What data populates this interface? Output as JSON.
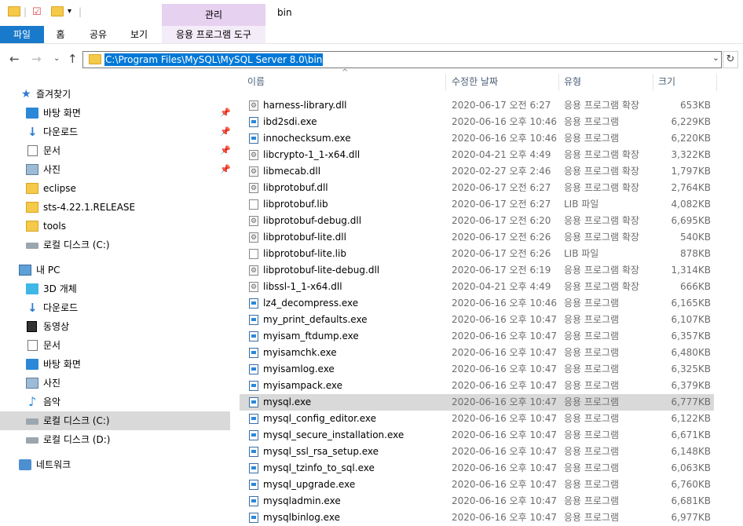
{
  "window": {
    "title": "bin",
    "manage_tab": "관리"
  },
  "ribbon": {
    "tabs": [
      "파일",
      "홈",
      "공유",
      "보기",
      "응용 프로그램 도구"
    ]
  },
  "address": {
    "path": "C:\\Program Files\\MySQL\\MySQL Server 8.0\\bin"
  },
  "nav": {
    "items": [
      {
        "label": "즐겨찾기",
        "icon": "star-icon"
      },
      {
        "label": "바탕 화면",
        "icon": "desktop-icon",
        "pinned": true
      },
      {
        "label": "다운로드",
        "icon": "download-icon",
        "pinned": true
      },
      {
        "label": "문서",
        "icon": "document-icon",
        "pinned": true
      },
      {
        "label": "사진",
        "icon": "pictures-icon",
        "pinned": true
      },
      {
        "label": "eclipse",
        "icon": "folder-icon"
      },
      {
        "label": "sts-4.22.1.RELEASE",
        "icon": "folder-icon"
      },
      {
        "label": "tools",
        "icon": "folder-icon"
      },
      {
        "label": "로컬 디스크 (C:)",
        "icon": "drive-icon"
      },
      {
        "label": "내 PC",
        "icon": "pc-icon"
      },
      {
        "label": "3D 개체",
        "icon": "3d-objects-icon"
      },
      {
        "label": "다운로드",
        "icon": "download-icon"
      },
      {
        "label": "동영상",
        "icon": "video-icon"
      },
      {
        "label": "문서",
        "icon": "document-icon"
      },
      {
        "label": "바탕 화면",
        "icon": "desktop-icon"
      },
      {
        "label": "사진",
        "icon": "pictures-icon"
      },
      {
        "label": "음악",
        "icon": "music-icon"
      },
      {
        "label": "로컬 디스크 (C:)",
        "icon": "drive-icon"
      },
      {
        "label": "로컬 디스크 (D:)",
        "icon": "drive-icon"
      },
      {
        "label": "네트워크",
        "icon": "network-icon"
      }
    ]
  },
  "columns": {
    "name": "이름",
    "date": "수정한 날짜",
    "type": "유형",
    "size": "크기"
  },
  "files": [
    {
      "name": "harness-library.dll",
      "date": "2020-06-17 오전 6:27",
      "type": "응용 프로그램 확장",
      "size": "653KB",
      "kind": "dll"
    },
    {
      "name": "ibd2sdi.exe",
      "date": "2020-06-16 오후 10:46",
      "type": "응용 프로그램",
      "size": "6,229KB",
      "kind": "exe"
    },
    {
      "name": "innochecksum.exe",
      "date": "2020-06-16 오후 10:46",
      "type": "응용 프로그램",
      "size": "6,220KB",
      "kind": "exe"
    },
    {
      "name": "libcrypto-1_1-x64.dll",
      "date": "2020-04-21 오후 4:49",
      "type": "응용 프로그램 확장",
      "size": "3,322KB",
      "kind": "dll"
    },
    {
      "name": "libmecab.dll",
      "date": "2020-02-27 오후 2:46",
      "type": "응용 프로그램 확장",
      "size": "1,797KB",
      "kind": "dll"
    },
    {
      "name": "libprotobuf.dll",
      "date": "2020-06-17 오전 6:27",
      "type": "응용 프로그램 확장",
      "size": "2,764KB",
      "kind": "dll"
    },
    {
      "name": "libprotobuf.lib",
      "date": "2020-06-17 오전 6:27",
      "type": "LIB 파일",
      "size": "4,082KB",
      "kind": "lib"
    },
    {
      "name": "libprotobuf-debug.dll",
      "date": "2020-06-17 오전 6:20",
      "type": "응용 프로그램 확장",
      "size": "6,695KB",
      "kind": "dll"
    },
    {
      "name": "libprotobuf-lite.dll",
      "date": "2020-06-17 오전 6:26",
      "type": "응용 프로그램 확장",
      "size": "540KB",
      "kind": "dll"
    },
    {
      "name": "libprotobuf-lite.lib",
      "date": "2020-06-17 오전 6:26",
      "type": "LIB 파일",
      "size": "878KB",
      "kind": "lib"
    },
    {
      "name": "libprotobuf-lite-debug.dll",
      "date": "2020-06-17 오전 6:19",
      "type": "응용 프로그램 확장",
      "size": "1,314KB",
      "kind": "dll"
    },
    {
      "name": "libssl-1_1-x64.dll",
      "date": "2020-04-21 오후 4:49",
      "type": "응용 프로그램 확장",
      "size": "666KB",
      "kind": "dll"
    },
    {
      "name": "lz4_decompress.exe",
      "date": "2020-06-16 오후 10:46",
      "type": "응용 프로그램",
      "size": "6,165KB",
      "kind": "exe"
    },
    {
      "name": "my_print_defaults.exe",
      "date": "2020-06-16 오후 10:47",
      "type": "응용 프로그램",
      "size": "6,107KB",
      "kind": "exe"
    },
    {
      "name": "myisam_ftdump.exe",
      "date": "2020-06-16 오후 10:47",
      "type": "응용 프로그램",
      "size": "6,357KB",
      "kind": "exe"
    },
    {
      "name": "myisamchk.exe",
      "date": "2020-06-16 오후 10:47",
      "type": "응용 프로그램",
      "size": "6,480KB",
      "kind": "exe"
    },
    {
      "name": "myisamlog.exe",
      "date": "2020-06-16 오후 10:47",
      "type": "응용 프로그램",
      "size": "6,325KB",
      "kind": "exe"
    },
    {
      "name": "myisampack.exe",
      "date": "2020-06-16 오후 10:47",
      "type": "응용 프로그램",
      "size": "6,379KB",
      "kind": "exe"
    },
    {
      "name": "mysql.exe",
      "date": "2020-06-16 오후 10:47",
      "type": "응용 프로그램",
      "size": "6,777KB",
      "kind": "exe",
      "selected": true
    },
    {
      "name": "mysql_config_editor.exe",
      "date": "2020-06-16 오후 10:47",
      "type": "응용 프로그램",
      "size": "6,122KB",
      "kind": "exe"
    },
    {
      "name": "mysql_secure_installation.exe",
      "date": "2020-06-16 오후 10:47",
      "type": "응용 프로그램",
      "size": "6,671KB",
      "kind": "exe"
    },
    {
      "name": "mysql_ssl_rsa_setup.exe",
      "date": "2020-06-16 오후 10:47",
      "type": "응용 프로그램",
      "size": "6,148KB",
      "kind": "exe"
    },
    {
      "name": "mysql_tzinfo_to_sql.exe",
      "date": "2020-06-16 오후 10:47",
      "type": "응용 프로그램",
      "size": "6,063KB",
      "kind": "exe"
    },
    {
      "name": "mysql_upgrade.exe",
      "date": "2020-06-16 오후 10:47",
      "type": "응용 프로그램",
      "size": "6,760KB",
      "kind": "exe"
    },
    {
      "name": "mysqladmin.exe",
      "date": "2020-06-16 오후 10:47",
      "type": "응용 프로그램",
      "size": "6,681KB",
      "kind": "exe"
    },
    {
      "name": "mysqlbinlog.exe",
      "date": "2020-06-16 오후 10:47",
      "type": "응용 프로그램",
      "size": "6,977KB",
      "kind": "exe"
    }
  ]
}
